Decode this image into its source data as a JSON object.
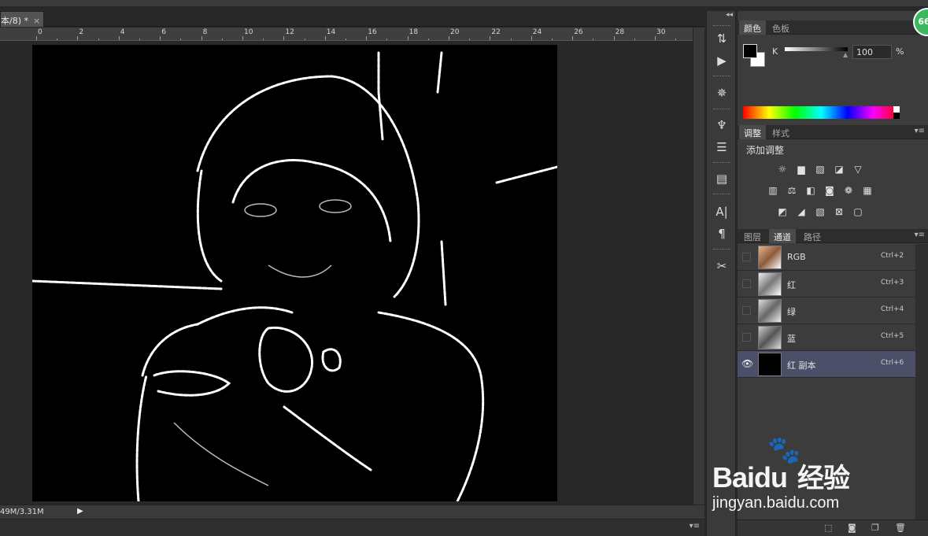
{
  "document": {
    "tab_title": "本/8) *",
    "close_glyph": "×"
  },
  "ruler": {
    "labels": [
      "0",
      "2",
      "4",
      "6",
      "8",
      "10",
      "12",
      "14",
      "16",
      "18",
      "20",
      "22",
      "24",
      "26",
      "28",
      "30"
    ]
  },
  "status": {
    "doc_size": "49M/3.31M"
  },
  "panels": {
    "color": {
      "tabs": [
        "颜色",
        "色板"
      ],
      "channel_label": "K",
      "value": "100",
      "unit": "%"
    },
    "adjustments": {
      "tabs": [
        "调整",
        "样式"
      ],
      "title": "添加调整"
    },
    "channels": {
      "tabs": [
        "图层",
        "通道",
        "路径"
      ],
      "rows": [
        {
          "name": "RGB",
          "shortcut": "Ctrl+2",
          "visible": false
        },
        {
          "name": "红",
          "shortcut": "Ctrl+3",
          "visible": false
        },
        {
          "name": "绿",
          "shortcut": "Ctrl+4",
          "visible": false
        },
        {
          "name": "蓝",
          "shortcut": "Ctrl+5",
          "visible": false
        },
        {
          "name": "红 副本",
          "shortcut": "Ctrl+6",
          "visible": true
        }
      ]
    }
  },
  "badge": {
    "text": "66"
  },
  "watermark": {
    "brand": "Bai",
    "brand2": "du",
    "cn": "经验",
    "url": "jingyan.baidu.com"
  },
  "colors": {
    "bg": "#282828",
    "panel": "#3c3c3c",
    "selected_row": "#4b5068",
    "badge": "#3bb75e"
  }
}
